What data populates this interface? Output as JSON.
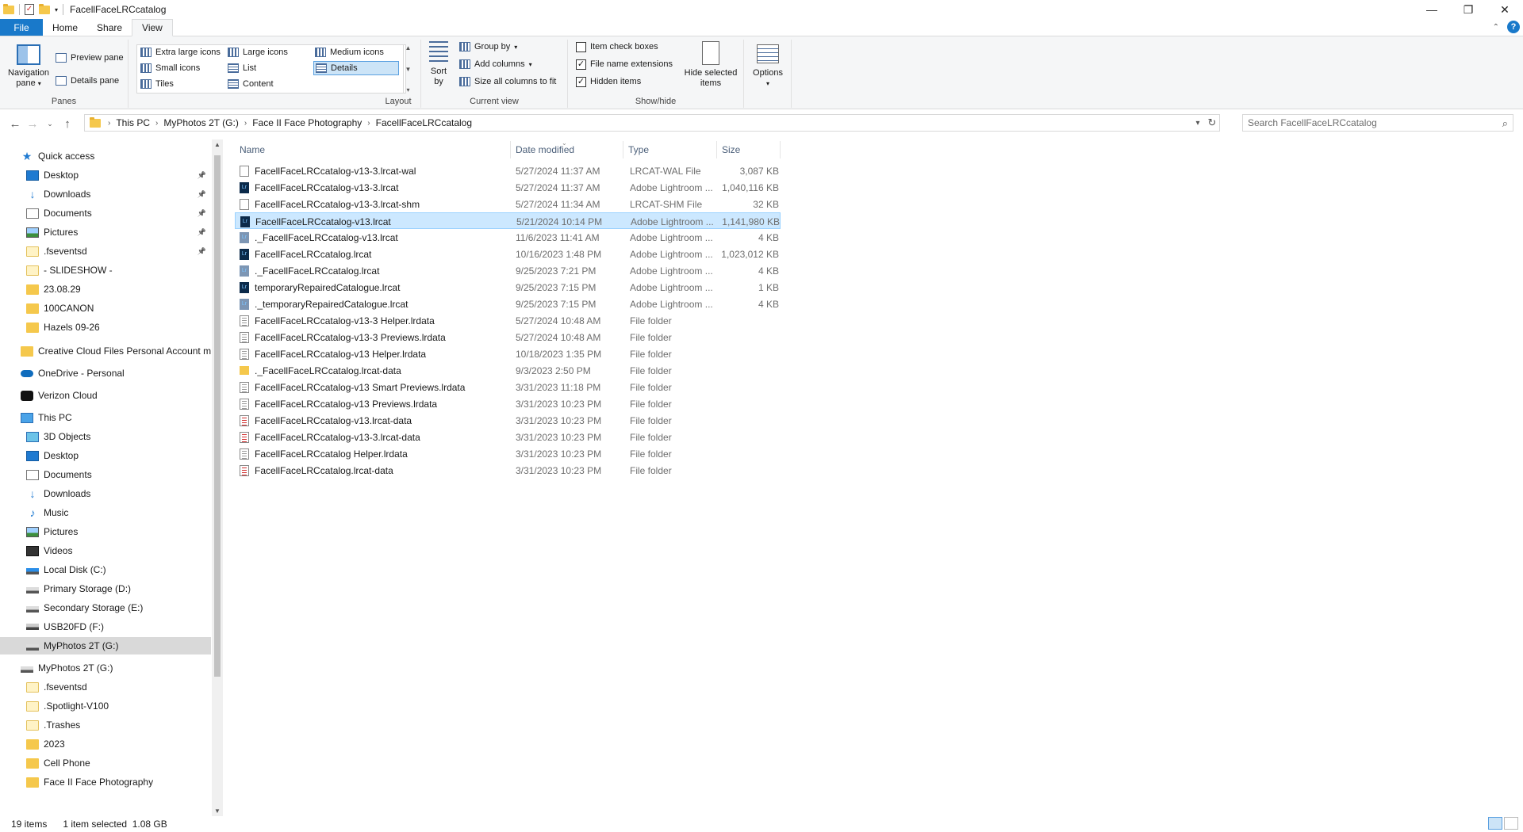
{
  "window": {
    "title": "FacellFaceLRCcatalog",
    "controls": {
      "minimize": "—",
      "maximize": "❐",
      "close": "✕"
    }
  },
  "ribbon_tabs": [
    "File",
    "Home",
    "Share",
    "View"
  ],
  "active_tab": "View",
  "ribbon": {
    "panes": {
      "navigation_pane": "Navigation\npane",
      "preview_pane": "Preview pane",
      "details_pane": "Details pane",
      "label": "Panes"
    },
    "layout": {
      "options": [
        "Extra large icons",
        "Large icons",
        "Medium icons",
        "Small icons",
        "List",
        "Details",
        "Tiles",
        "Content"
      ],
      "selected": "Details",
      "label": "Layout"
    },
    "current_view": {
      "sort_by": "Sort\nby",
      "group_by": "Group by",
      "add_columns": "Add columns",
      "size_all_columns": "Size all columns to fit",
      "label": "Current view"
    },
    "show_hide": {
      "item_check_boxes": "Item check boxes",
      "item_check_boxes_checked": false,
      "file_name_extensions": "File name extensions",
      "file_name_extensions_checked": true,
      "hidden_items": "Hidden items",
      "hidden_items_checked": true,
      "hide_selected_items": "Hide selected\nitems",
      "label": "Show/hide"
    },
    "options": "Options"
  },
  "address": {
    "crumbs": [
      "This PC",
      "MyPhotos 2T (G:)",
      "Face II Face Photography",
      "FacellFaceLRCcatalog"
    ]
  },
  "search": {
    "placeholder": "Search FacellFaceLRCcatalog"
  },
  "nav_pane": {
    "items": [
      {
        "label": "Quick access",
        "icon": "star-icon",
        "level": 0
      },
      {
        "label": "Desktop",
        "icon": "desktop-icon",
        "level": 1,
        "pinned": true
      },
      {
        "label": "Downloads",
        "icon": "downloads-icon",
        "level": 1,
        "pinned": true
      },
      {
        "label": "Documents",
        "icon": "documents-icon",
        "level": 1,
        "pinned": true
      },
      {
        "label": "Pictures",
        "icon": "pictures-icon",
        "level": 1,
        "pinned": true
      },
      {
        "label": ".fseventsd",
        "icon": "folder-empty-icon",
        "level": 1,
        "pinned": true
      },
      {
        "label": "- SLIDESHOW -",
        "icon": "folder-empty-icon",
        "level": 1
      },
      {
        "label": "23.08.29",
        "icon": "folder-icon",
        "level": 1
      },
      {
        "label": "100CANON",
        "icon": "folder-icon",
        "level": 1
      },
      {
        "label": "Hazels 09-26",
        "icon": "folder-icon",
        "level": 1
      },
      {
        "label": "Creative Cloud Files Personal Account mu",
        "icon": "folder-icon",
        "level": 0
      },
      {
        "label": "OneDrive - Personal",
        "icon": "onedrive-icon",
        "level": 0
      },
      {
        "label": "Verizon Cloud",
        "icon": "verizon-icon",
        "level": 0
      },
      {
        "label": "This PC",
        "icon": "pc-icon",
        "level": 0
      },
      {
        "label": "3D Objects",
        "icon": "3d-objects-icon",
        "level": 1
      },
      {
        "label": "Desktop",
        "icon": "desktop-icon",
        "level": 1
      },
      {
        "label": "Documents",
        "icon": "documents-icon",
        "level": 1
      },
      {
        "label": "Downloads",
        "icon": "downloads-icon",
        "level": 1
      },
      {
        "label": "Music",
        "icon": "music-icon",
        "level": 1
      },
      {
        "label": "Pictures",
        "icon": "pictures-icon",
        "level": 1
      },
      {
        "label": "Videos",
        "icon": "videos-icon",
        "level": 1
      },
      {
        "label": "Local Disk (C:)",
        "icon": "windows-disk-icon",
        "level": 1
      },
      {
        "label": "Primary Storage (D:)",
        "icon": "disk-icon",
        "level": 1
      },
      {
        "label": "Secondary Storage (E:)",
        "icon": "disk-icon",
        "level": 1
      },
      {
        "label": "USB20FD (F:)",
        "icon": "usb-icon",
        "level": 1
      },
      {
        "label": "MyPhotos 2T (G:)",
        "icon": "disk-icon",
        "level": 1,
        "selected": true
      },
      {
        "label": "MyPhotos 2T (G:)",
        "icon": "disk-icon",
        "level": 0
      },
      {
        "label": ".fseventsd",
        "icon": "folder-empty-icon",
        "level": 1
      },
      {
        "label": ".Spotlight-V100",
        "icon": "folder-empty-icon",
        "level": 1
      },
      {
        "label": ".Trashes",
        "icon": "folder-empty-icon",
        "level": 1
      },
      {
        "label": "2023",
        "icon": "folder-icon",
        "level": 1
      },
      {
        "label": "Cell Phone",
        "icon": "folder-icon",
        "level": 1
      },
      {
        "label": "Face II Face Photography",
        "icon": "folder-icon",
        "level": 1
      }
    ]
  },
  "columns": {
    "name": "Name",
    "date": "Date modified",
    "type": "Type",
    "size": "Size"
  },
  "files": [
    {
      "name": "FacellFaceLRCcatalog-v13-3.lrcat-wal",
      "date": "5/27/2024 11:37 AM",
      "type": "LRCAT-WAL File",
      "size": "3,087 KB",
      "icon": "file-icon"
    },
    {
      "name": "FacellFaceLRCcatalog-v13-3.lrcat",
      "date": "5/27/2024 11:37 AM",
      "type": "Adobe Lightroom ...",
      "size": "1,040,116 KB",
      "icon": "lightroom-icon"
    },
    {
      "name": "FacellFaceLRCcatalog-v13-3.lrcat-shm",
      "date": "5/27/2024 11:34 AM",
      "type": "LRCAT-SHM File",
      "size": "32 KB",
      "icon": "file-icon"
    },
    {
      "name": "FacellFaceLRCcatalog-v13.lrcat",
      "date": "5/21/2024 10:14 PM",
      "type": "Adobe Lightroom ...",
      "size": "1,141,980 KB",
      "icon": "lightroom-icon",
      "selected": true
    },
    {
      "name": "._FacellFaceLRCcatalog-v13.lrcat",
      "date": "11/6/2023 11:41 AM",
      "type": "Adobe Lightroom ...",
      "size": "4 KB",
      "icon": "lightroom-hidden-icon"
    },
    {
      "name": "FacellFaceLRCcatalog.lrcat",
      "date": "10/16/2023 1:48 PM",
      "type": "Adobe Lightroom ...",
      "size": "1,023,012 KB",
      "icon": "lightroom-icon"
    },
    {
      "name": "._FacellFaceLRCcatalog.lrcat",
      "date": "9/25/2023 7:21 PM",
      "type": "Adobe Lightroom ...",
      "size": "4 KB",
      "icon": "lightroom-hidden-icon"
    },
    {
      "name": "temporaryRepairedCatalogue.lrcat",
      "date": "9/25/2023 7:15 PM",
      "type": "Adobe Lightroom ...",
      "size": "1 KB",
      "icon": "lightroom-icon"
    },
    {
      "name": "._temporaryRepairedCatalogue.lrcat",
      "date": "9/25/2023 7:15 PM",
      "type": "Adobe Lightroom ...",
      "size": "4 KB",
      "icon": "lightroom-hidden-icon"
    },
    {
      "name": "FacellFaceLRCcatalog-v13-3 Helper.lrdata",
      "date": "5/27/2024 10:48 AM",
      "type": "File folder",
      "size": "",
      "icon": "lrdata-icon"
    },
    {
      "name": "FacellFaceLRCcatalog-v13-3 Previews.lrdata",
      "date": "5/27/2024 10:48 AM",
      "type": "File folder",
      "size": "",
      "icon": "lrdata-icon"
    },
    {
      "name": "FacellFaceLRCcatalog-v13 Helper.lrdata",
      "date": "10/18/2023 1:35 PM",
      "type": "File folder",
      "size": "",
      "icon": "lrdata-icon"
    },
    {
      "name": "._FacellFaceLRCcatalog.lrcat-data",
      "date": "9/3/2023 2:50 PM",
      "type": "File folder",
      "size": "",
      "icon": "folder-icon"
    },
    {
      "name": "FacellFaceLRCcatalog-v13 Smart Previews.lrdata",
      "date": "3/31/2023 11:18 PM",
      "type": "File folder",
      "size": "",
      "icon": "lrdata-icon"
    },
    {
      "name": "FacellFaceLRCcatalog-v13 Previews.lrdata",
      "date": "3/31/2023 10:23 PM",
      "type": "File folder",
      "size": "",
      "icon": "lrdata-icon"
    },
    {
      "name": "FacellFaceLRCcatalog-v13.lrcat-data",
      "date": "3/31/2023 10:23 PM",
      "type": "File folder",
      "size": "",
      "icon": "lrcat-data-icon"
    },
    {
      "name": "FacellFaceLRCcatalog-v13-3.lrcat-data",
      "date": "3/31/2023 10:23 PM",
      "type": "File folder",
      "size": "",
      "icon": "lrcat-data-icon"
    },
    {
      "name": "FacellFaceLRCcatalog Helper.lrdata",
      "date": "3/31/2023 10:23 PM",
      "type": "File folder",
      "size": "",
      "icon": "lrdata-icon"
    },
    {
      "name": "FacellFaceLRCcatalog.lrcat-data",
      "date": "3/31/2023 10:23 PM",
      "type": "File folder",
      "size": "",
      "icon": "lrcat-data-icon"
    }
  ],
  "status": {
    "count": "19 items",
    "selection": "1 item selected  1.08 GB"
  },
  "colors": {
    "accent": "#1979ca",
    "selection": "#cce8ff",
    "ribbon_bg": "#f5f6f7"
  }
}
